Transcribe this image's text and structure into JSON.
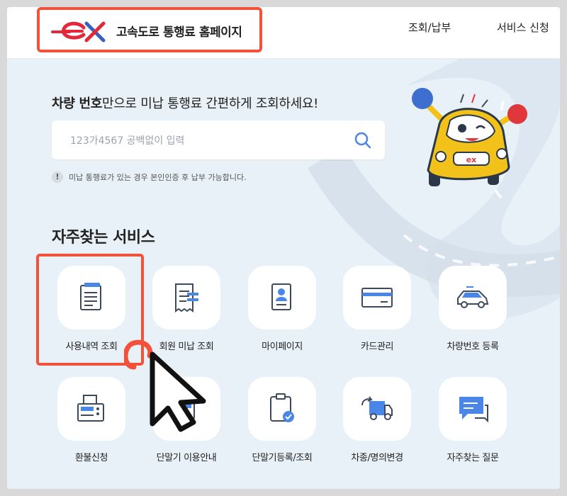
{
  "header": {
    "logo_text": "고속도로 통행료 홈페이지",
    "nav": [
      "조회/납부",
      "서비스 신청"
    ]
  },
  "search": {
    "headline_bold": "차량 번호",
    "headline_rest": "만으로 미납 통행료 간편하게 조회하세요!",
    "placeholder": "123가4567 공백없이 입력",
    "notice_icon": "!",
    "notice": "미납 통행료가 있는 경우 본인인증 후 납부 가능합니다."
  },
  "services": {
    "title": "자주찾는 서비스",
    "items": [
      {
        "label": "사용내역 조회",
        "icon": "document-list-icon"
      },
      {
        "label": "회원 미납 조회",
        "icon": "receipt-icon"
      },
      {
        "label": "마이페이지",
        "icon": "profile-card-icon"
      },
      {
        "label": "카드관리",
        "icon": "card-icon"
      },
      {
        "label": "차량번호 등록",
        "icon": "car-icon"
      },
      {
        "label": "환불신청",
        "icon": "fax-printer-icon"
      },
      {
        "label": "단말기 이용안내",
        "icon": "terminal-icon"
      },
      {
        "label": "단말기등록/조회",
        "icon": "clipboard-check-icon"
      },
      {
        "label": "차종/명의변경",
        "icon": "truck-swap-icon"
      },
      {
        "label": "자주찾는 질문",
        "icon": "chat-bubble-icon"
      }
    ]
  },
  "colors": {
    "brand_red": "#e5273a",
    "brand_blue": "#3a5fbf",
    "highlight": "#f4513a",
    "icon_blue": "#4a86e8",
    "icon_dark": "#3d4a5c"
  }
}
